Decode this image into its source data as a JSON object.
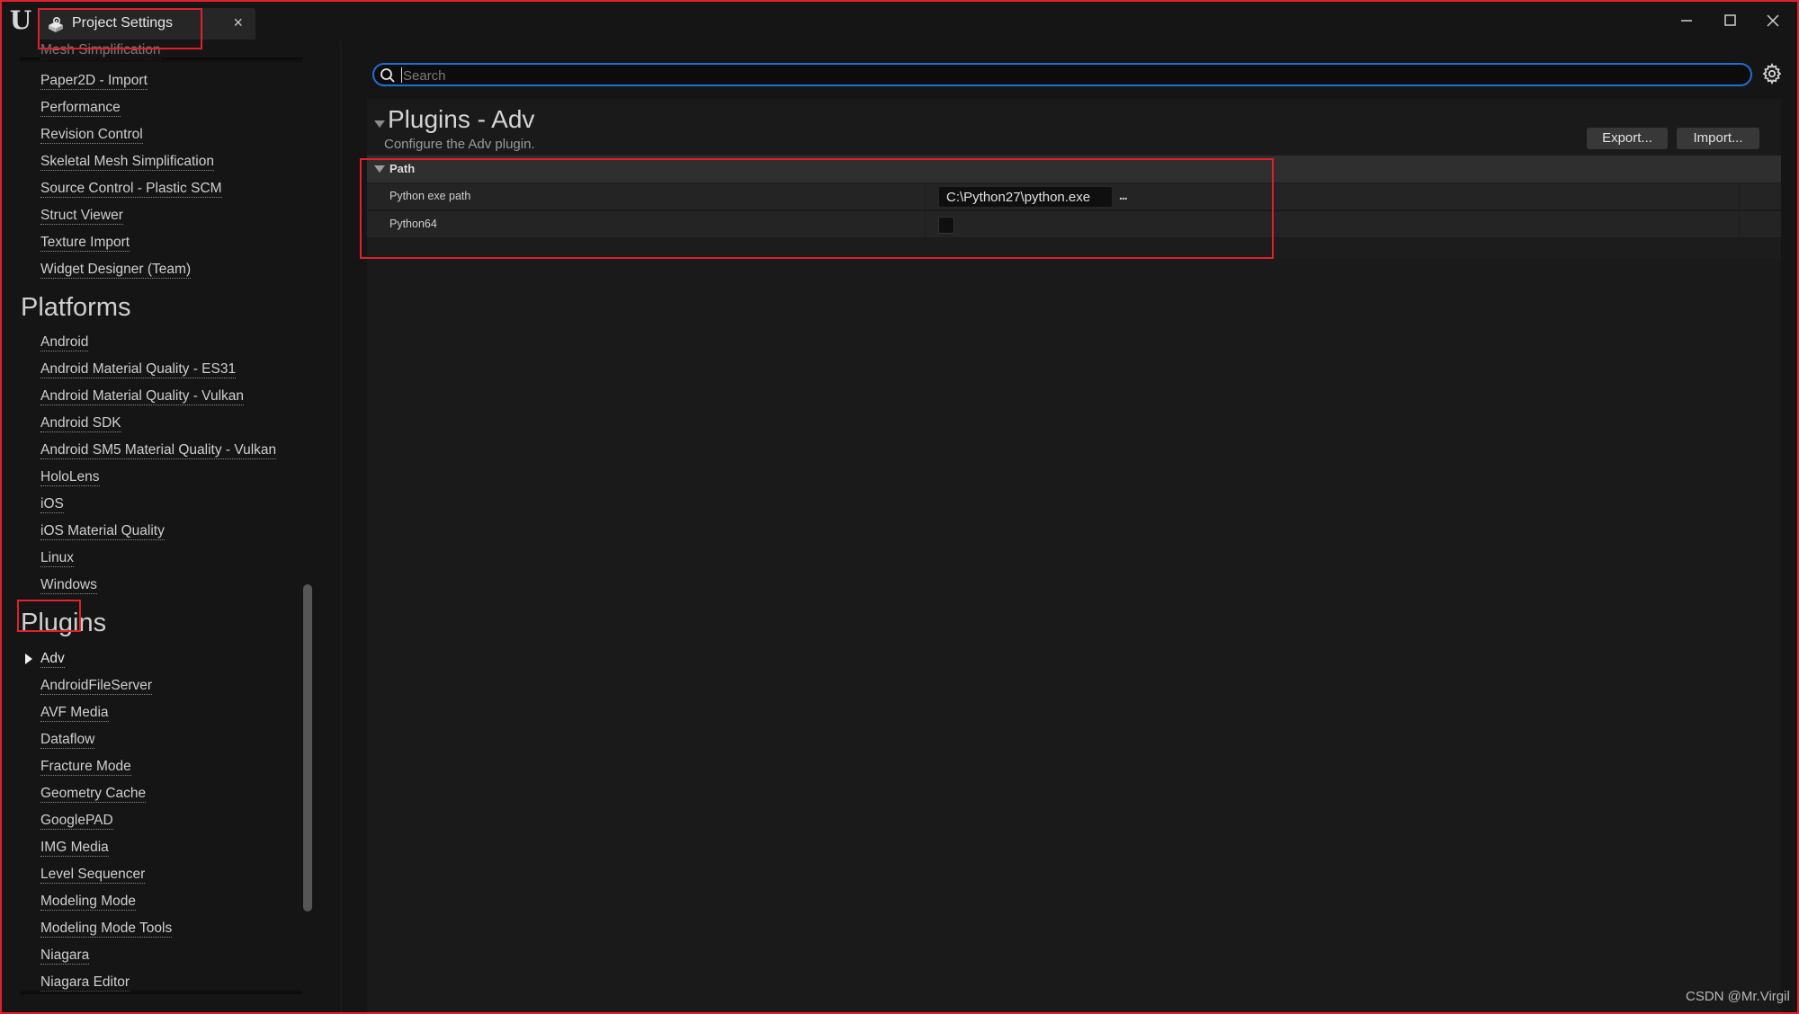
{
  "window": {
    "tab_title": "Project Settings",
    "tab_icon": "project-settings-icon",
    "close_tab_symbol": "×",
    "controls": {
      "minimize": "minimize-icon",
      "maximize": "maximize-icon",
      "close": "close-icon"
    }
  },
  "sidebar": {
    "partial_top_item": "Mesh Simplification",
    "items_top": [
      "Paper2D - Import",
      "Performance",
      "Revision Control",
      "Skeletal Mesh Simplification",
      "Source Control - Plastic SCM",
      "Struct Viewer",
      "Texture Import",
      "Widget Designer (Team)"
    ],
    "sections": [
      {
        "heading": "Platforms",
        "items": [
          "Android",
          "Android Material Quality - ES31",
          "Android Material Quality - Vulkan",
          "Android SDK",
          "Android SM5 Material Quality - Vulkan",
          "HoloLens",
          "iOS",
          "iOS Material Quality",
          "Linux",
          "Windows"
        ]
      },
      {
        "heading": "Plugins",
        "selected": "Adv",
        "items": [
          "Adv",
          "AndroidFileServer",
          "AVF Media",
          "Dataflow",
          "Fracture Mode",
          "Geometry Cache",
          "GooglePAD",
          "IMG Media",
          "Level Sequencer",
          "Modeling Mode",
          "Modeling Mode Tools",
          "Niagara",
          "Niagara Editor"
        ]
      }
    ]
  },
  "search": {
    "placeholder": "Search",
    "value": ""
  },
  "main": {
    "title": "Plugins - Adv",
    "description": "Configure the Adv plugin.",
    "export_label": "Export...",
    "import_label": "Import...",
    "category": {
      "title": "Path",
      "properties": [
        {
          "name": "Python exe path",
          "type": "text",
          "value": "C:\\Python27\\python.exe",
          "browse_label": "..."
        },
        {
          "name": "Python64",
          "type": "checkbox",
          "checked": false
        }
      ]
    }
  },
  "watermark": "CSDN @Mr.Virgil",
  "colors": {
    "highlight_red": "#e0202a",
    "search_focus_blue": "#1f6fd1",
    "background": "#151515"
  }
}
